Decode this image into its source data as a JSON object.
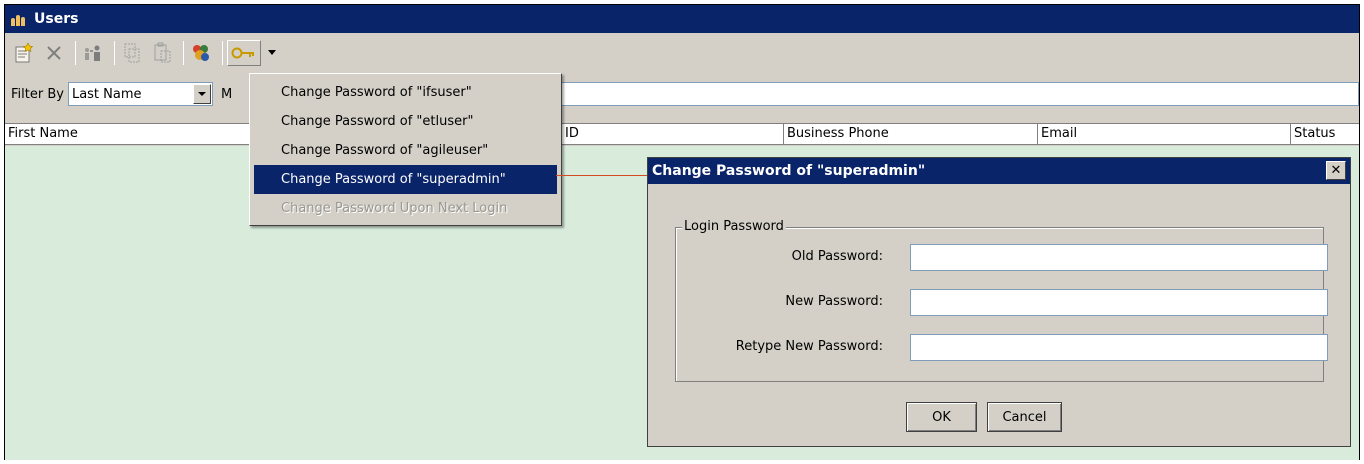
{
  "window": {
    "title": "Users",
    "app_icon": "users-app-icon"
  },
  "toolbar": {
    "icons": [
      "new-user-icon",
      "delete-icon",
      "assign-icon",
      "copy-icon",
      "paste-icon",
      "group-icon",
      "key-icon",
      "dropdown-arrow-icon"
    ]
  },
  "filter": {
    "label": "Filter By",
    "field_value": "Last Name",
    "match_label": "M",
    "search_value": ""
  },
  "grid": {
    "columns": [
      "First Name",
      "ID",
      "Business Phone",
      "Email",
      "Status"
    ],
    "body_color": "#d9ecdc"
  },
  "menu": {
    "items": [
      {
        "label": "Change Password of \"ifsuser\"",
        "state": "normal"
      },
      {
        "label": "Change Password of \"etluser\"",
        "state": "normal"
      },
      {
        "label": "Change Password of \"agileuser\"",
        "state": "normal"
      },
      {
        "label": "Change Password of \"superadmin\"",
        "state": "selected"
      },
      {
        "label": "Change Password Upon Next Login",
        "state": "disabled"
      }
    ]
  },
  "dialog": {
    "title": "Change Password of \"superadmin\"",
    "close_label": "✕",
    "group_label": "Login Password",
    "fields": [
      {
        "label": "Old Password:",
        "value": ""
      },
      {
        "label": "New Password:",
        "value": ""
      },
      {
        "label": "Retype New Password:",
        "value": ""
      }
    ],
    "ok_label": "OK",
    "cancel_label": "Cancel"
  },
  "colors": {
    "title_bar": "#0a246a",
    "window_bg": "#d4d0c8",
    "selection": "#0a246a",
    "connector_line": "#d44a22"
  }
}
